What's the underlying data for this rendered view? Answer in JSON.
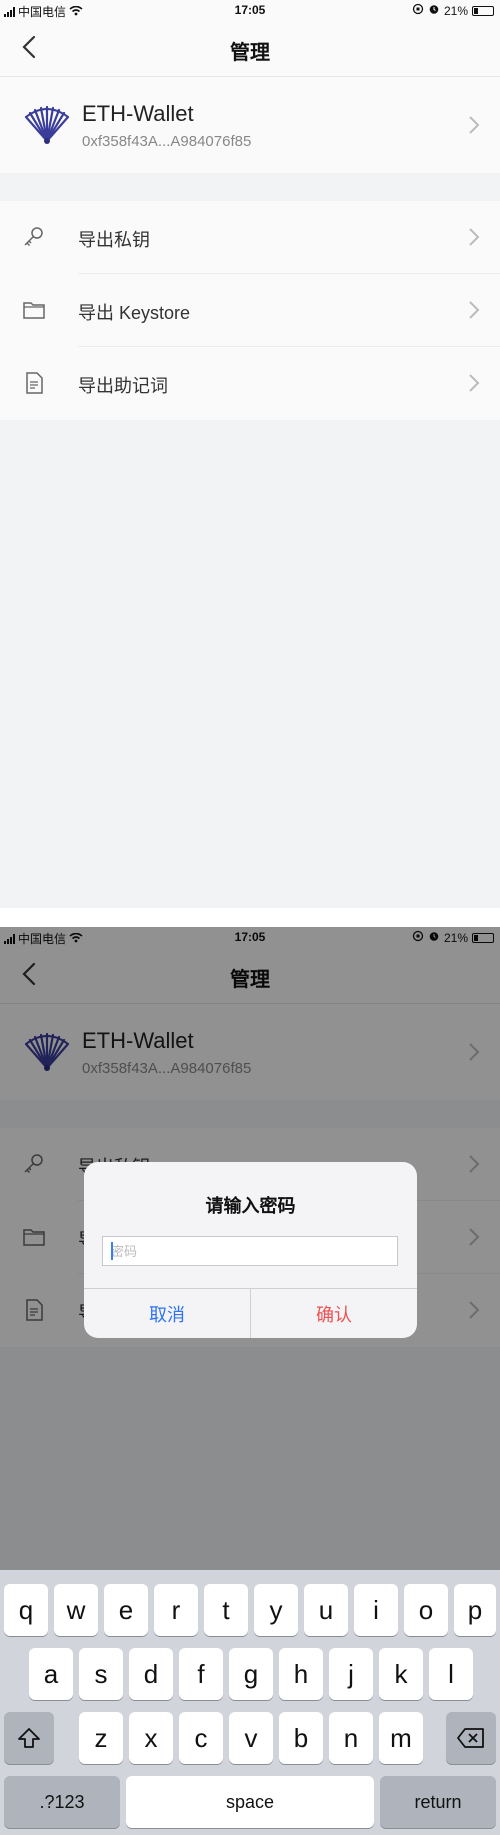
{
  "status_bar": {
    "carrier": "中国电信",
    "time": "17:05",
    "battery": "21%"
  },
  "nav": {
    "title": "管理"
  },
  "wallet": {
    "name": "ETH-Wallet",
    "address": "0xf358f43A...A984076f85"
  },
  "menu": [
    {
      "label": "导出私钥",
      "icon": "key-icon"
    },
    {
      "label": "导出 Keystore",
      "icon": "folder-icon"
    },
    {
      "label": "导出助记词",
      "icon": "document-icon"
    }
  ],
  "dialog": {
    "title": "请输入密码",
    "placeholder": "密码",
    "cancel": "取消",
    "confirm": "确认"
  },
  "keyboard": {
    "row1": [
      "q",
      "w",
      "e",
      "r",
      "t",
      "y",
      "u",
      "i",
      "o",
      "p"
    ],
    "row2": [
      "a",
      "s",
      "d",
      "f",
      "g",
      "h",
      "j",
      "k",
      "l"
    ],
    "row3": [
      "z",
      "x",
      "c",
      "v",
      "b",
      "n",
      "m"
    ],
    "numbers_key": ".?123",
    "space_key": "space",
    "return_key": "return"
  },
  "colors": {
    "cancel": "#2f73f0",
    "confirm": "#f05050",
    "caret": "#3c7cf6"
  }
}
